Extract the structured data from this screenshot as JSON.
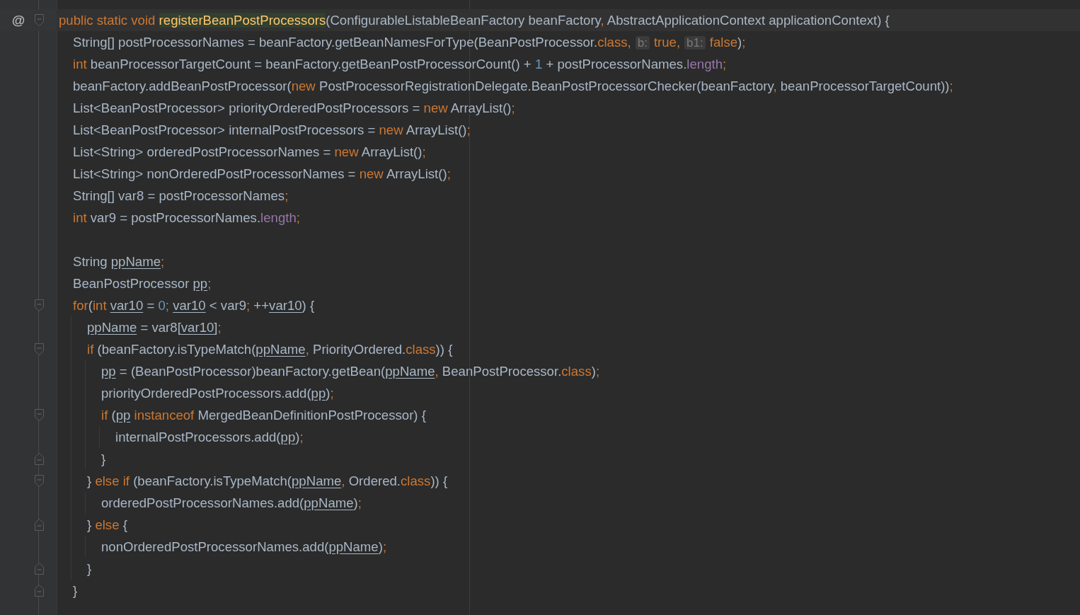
{
  "editor": {
    "lines": [
      {
        "marker": "@",
        "kind": "block_start",
        "current": true,
        "tokens": [
          {
            "kind": "kw",
            "text": "public static void "
          },
          {
            "kind": "decl",
            "text": "registerBeanPostProcessors"
          },
          {
            "kind": "id",
            "text": "(ConfigurableListableBeanFactory beanFactory"
          },
          {
            "kind": "kw",
            "text": ", "
          },
          {
            "kind": "id",
            "text": "AbstractApplicationContext applicationContext) {"
          }
        ],
        "children": [
          {
            "current": false,
            "tokens": [
              {
                "kind": "id",
                "text": "String[] postProcessorNames = beanFactory.getBeanNamesForType(BeanPostProcessor."
              },
              {
                "kind": "kw",
                "text": "class,"
              },
              {
                "kind": "hint",
                "text": "b:"
              },
              {
                "kind": "kw",
                "text": "true,"
              },
              {
                "kind": "hint",
                "text": "b1:"
              },
              {
                "kind": "kw",
                "text": "false"
              },
              {
                "kind": "id",
                "text": ")"
              },
              {
                "kind": "kw",
                "text": ";"
              }
            ]
          },
          {
            "current": false,
            "tokens": [
              {
                "kind": "kw",
                "text": "int"
              },
              {
                "kind": "id",
                "text": " beanProcessorTargetCount = beanFactory.getBeanPostProcessorCount() + "
              },
              {
                "kind": "num",
                "text": "1"
              },
              {
                "kind": "id",
                "text": " + postProcessorNames."
              },
              {
                "kind": "field",
                "text": "length"
              },
              {
                "kind": "kw",
                "text": ";"
              }
            ]
          },
          {
            "current": false,
            "tokens": [
              {
                "kind": "id",
                "text": "beanFactory.addBeanPostProcessor("
              },
              {
                "kind": "kw",
                "text": "new"
              },
              {
                "kind": "id",
                "text": " PostProcessorRegistrationDelegate.BeanPostProcessorChecker(beanFactory"
              },
              {
                "kind": "kw",
                "text": ", "
              },
              {
                "kind": "id",
                "text": "beanProcessorTargetCount))"
              },
              {
                "kind": "kw",
                "text": ";"
              }
            ]
          },
          {
            "current": false,
            "tokens": [
              {
                "kind": "id",
                "text": "List<BeanPostProcessor> priorityOrderedPostProcessors = "
              },
              {
                "kind": "kw",
                "text": "new"
              },
              {
                "kind": "id",
                "text": " ArrayList()"
              },
              {
                "kind": "kw",
                "text": ";"
              }
            ]
          },
          {
            "current": false,
            "tokens": [
              {
                "kind": "id",
                "text": "List<BeanPostProcessor> internalPostProcessors = "
              },
              {
                "kind": "kw",
                "text": "new"
              },
              {
                "kind": "id",
                "text": " ArrayList()"
              },
              {
                "kind": "kw",
                "text": ";"
              }
            ]
          },
          {
            "current": false,
            "tokens": [
              {
                "kind": "id",
                "text": "List<String> orderedPostProcessorNames = "
              },
              {
                "kind": "kw",
                "text": "new"
              },
              {
                "kind": "id",
                "text": " ArrayList()"
              },
              {
                "kind": "kw",
                "text": ";"
              }
            ]
          },
          {
            "current": false,
            "tokens": [
              {
                "kind": "id",
                "text": "List<String> nonOrderedPostProcessorNames = "
              },
              {
                "kind": "kw",
                "text": "new"
              },
              {
                "kind": "id",
                "text": " ArrayList()"
              },
              {
                "kind": "kw",
                "text": ";"
              }
            ]
          },
          {
            "current": false,
            "tokens": [
              {
                "kind": "id",
                "text": "String[] var8 = postProcessorNames"
              },
              {
                "kind": "kw",
                "text": ";"
              }
            ]
          },
          {
            "current": false,
            "tokens": [
              {
                "kind": "kw",
                "text": "int"
              },
              {
                "kind": "id",
                "text": " var9 = postProcessorNames."
              },
              {
                "kind": "field",
                "text": "length"
              },
              {
                "kind": "kw",
                "text": ";"
              }
            ]
          },
          {
            "kind": "blank",
            "current": false
          },
          {
            "current": false,
            "tokens": [
              {
                "kind": "id",
                "text": "String "
              },
              {
                "kind": "var",
                "text": "ppName"
              },
              {
                "kind": "kw",
                "text": ";"
              }
            ]
          },
          {
            "current": false,
            "tokens": [
              {
                "kind": "id",
                "text": "BeanPostProcessor "
              },
              {
                "kind": "var",
                "text": "pp"
              },
              {
                "kind": "kw",
                "text": ";"
              }
            ]
          },
          {
            "kind": "block_start",
            "current": false,
            "tokens": [
              {
                "kind": "kw",
                "text": "for"
              },
              {
                "kind": "id",
                "text": "("
              },
              {
                "kind": "kw",
                "text": "int "
              },
              {
                "kind": "var",
                "text": "var10"
              },
              {
                "kind": "id",
                "text": " = "
              },
              {
                "kind": "num",
                "text": "0"
              },
              {
                "kind": "kw",
                "text": "; "
              },
              {
                "kind": "var",
                "text": "var10"
              },
              {
                "kind": "id",
                "text": " < var9"
              },
              {
                "kind": "kw",
                "text": "; "
              },
              {
                "kind": "id",
                "text": "++"
              },
              {
                "kind": "var",
                "text": "var10"
              },
              {
                "kind": "id",
                "text": ") {"
              }
            ],
            "children": [
              {
                "current": false,
                "tokens": [
                  {
                    "kind": "var",
                    "text": "ppName"
                  },
                  {
                    "kind": "id",
                    "text": " = var8["
                  },
                  {
                    "kind": "var",
                    "text": "var10"
                  },
                  {
                    "kind": "id",
                    "text": "]"
                  },
                  {
                    "kind": "kw",
                    "text": ";"
                  }
                ]
              },
              {
                "kind": "block_start",
                "current": false,
                "tokens": [
                  {
                    "kind": "kw",
                    "text": "if"
                  },
                  {
                    "kind": "id",
                    "text": " (beanFactory.isTypeMatch("
                  },
                  {
                    "kind": "var",
                    "text": "ppName"
                  },
                  {
                    "kind": "kw",
                    "text": ", "
                  },
                  {
                    "kind": "id",
                    "text": "PriorityOrdered."
                  },
                  {
                    "kind": "kw",
                    "text": "class"
                  },
                  {
                    "kind": "id",
                    "text": ")) {"
                  }
                ],
                "children": [
                  {
                    "current": false,
                    "tokens": [
                      {
                        "kind": "var",
                        "text": "pp"
                      },
                      {
                        "kind": "id",
                        "text": " = (BeanPostProcessor)beanFactory.getBean("
                      },
                      {
                        "kind": "var",
                        "text": "ppName"
                      },
                      {
                        "kind": "kw",
                        "text": ", "
                      },
                      {
                        "kind": "id",
                        "text": "BeanPostProcessor."
                      },
                      {
                        "kind": "kw",
                        "text": "class"
                      },
                      {
                        "kind": "id",
                        "text": ")"
                      },
                      {
                        "kind": "kw",
                        "text": ";"
                      }
                    ]
                  },
                  {
                    "current": false,
                    "tokens": [
                      {
                        "kind": "id",
                        "text": "priorityOrderedPostProcessors.add("
                      },
                      {
                        "kind": "var",
                        "text": "pp"
                      },
                      {
                        "kind": "id",
                        "text": ")"
                      },
                      {
                        "kind": "kw",
                        "text": ";"
                      }
                    ]
                  },
                  {
                    "kind": "block_start",
                    "current": false,
                    "tokens": [
                      {
                        "kind": "kw",
                        "text": "if"
                      },
                      {
                        "kind": "id",
                        "text": " ("
                      },
                      {
                        "kind": "var",
                        "text": "pp"
                      },
                      {
                        "kind": "kw",
                        "text": " instanceof"
                      },
                      {
                        "kind": "id",
                        "text": " MergedBeanDefinitionPostProcessor) {"
                      }
                    ],
                    "children": [
                      {
                        "current": false,
                        "tokens": [
                          {
                            "kind": "id",
                            "text": "internalPostProcessors.add("
                          },
                          {
                            "kind": "var",
                            "text": "pp"
                          },
                          {
                            "kind": "id",
                            "text": ")"
                          },
                          {
                            "kind": "kw",
                            "text": ";"
                          }
                        ]
                      }
                    ]
                  },
                  {
                    "kind": "block_end",
                    "current": false,
                    "tokens": [
                      {
                        "kind": "id",
                        "text": "}"
                      }
                    ]
                  }
                ]
              },
              {
                "kind": "block_start",
                "current": false,
                "tokens": [
                  {
                    "kind": "id",
                    "text": "} "
                  },
                  {
                    "kind": "kw",
                    "text": "else if"
                  },
                  {
                    "kind": "id",
                    "text": " (beanFactory.isTypeMatch("
                  },
                  {
                    "kind": "var",
                    "text": "ppName"
                  },
                  {
                    "kind": "kw",
                    "text": ", "
                  },
                  {
                    "kind": "id",
                    "text": "Ordered."
                  },
                  {
                    "kind": "kw",
                    "text": "class"
                  },
                  {
                    "kind": "id",
                    "text": ")) {"
                  }
                ],
                "children": [
                  {
                    "current": false,
                    "tokens": [
                      {
                        "kind": "id",
                        "text": "orderedPostProcessorNames.add("
                      },
                      {
                        "kind": "var",
                        "text": "ppName"
                      },
                      {
                        "kind": "id",
                        "text": ")"
                      },
                      {
                        "kind": "kw",
                        "text": ";"
                      }
                    ]
                  }
                ]
              },
              {
                "kind": "block_end",
                "current": false,
                "tokens": [
                  {
                    "kind": "id",
                    "text": "} "
                  },
                  {
                    "kind": "kw",
                    "text": "else"
                  },
                  {
                    "kind": "id",
                    "text": " {"
                  }
                ],
                "children": [
                  {
                    "current": false,
                    "tokens": [
                      {
                        "kind": "id",
                        "text": "nonOrderedPostProcessorNames.add("
                      },
                      {
                        "kind": "var",
                        "text": "ppName"
                      },
                      {
                        "kind": "id",
                        "text": ")"
                      },
                      {
                        "kind": "kw",
                        "text": ";"
                      }
                    ]
                  }
                ]
              },
              {
                "kind": "block_end",
                "current": false,
                "tokens": [
                  {
                    "kind": "id",
                    "text": "}"
                  }
                ]
              }
            ]
          },
          {
            "kind": "block_end",
            "current": false,
            "tokens": [
              {
                "kind": "id",
                "text": "}"
              }
            ]
          }
        ]
      }
    ]
  }
}
